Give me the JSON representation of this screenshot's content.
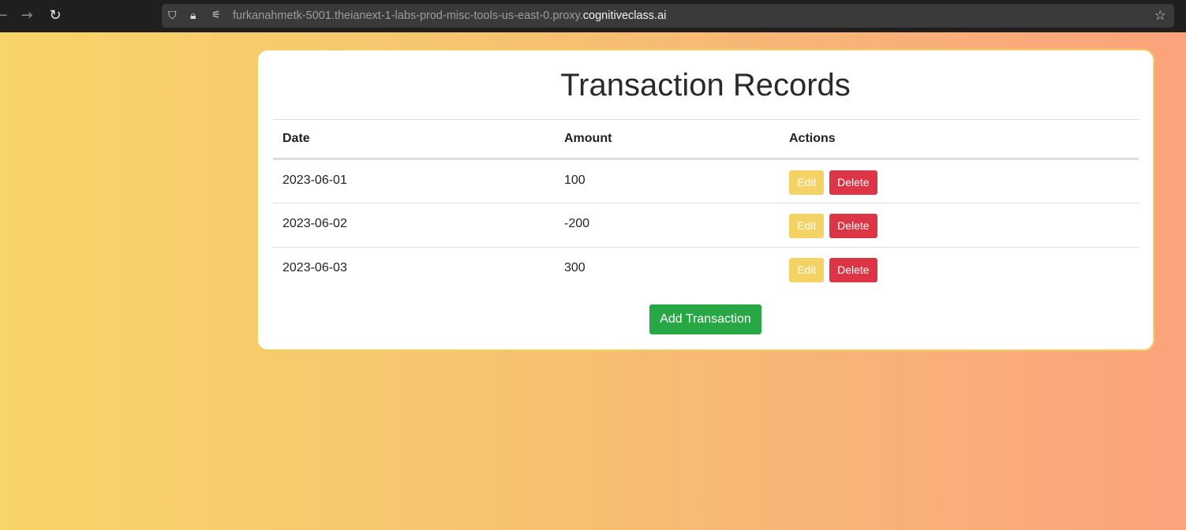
{
  "browser": {
    "url_dim": "furkanahmetk-5001.theianext-1-labs-prod-misc-tools-us-east-0.proxy.",
    "url_bright": "cognitiveclass.ai"
  },
  "page": {
    "title": "Transaction Records",
    "columns": [
      "Date",
      "Amount",
      "Actions"
    ],
    "rows": [
      {
        "date": "2023-06-01",
        "amount": "100",
        "edit": "Edit",
        "delete": "Delete"
      },
      {
        "date": "2023-06-02",
        "amount": "-200",
        "edit": "Edit",
        "delete": "Delete"
      },
      {
        "date": "2023-06-03",
        "amount": "300",
        "edit": "Edit",
        "delete": "Delete"
      }
    ],
    "add_label": "Add Transaction"
  },
  "colors": {
    "edit": "#f4d264",
    "delete": "#dc3545",
    "add": "#28a745"
  }
}
